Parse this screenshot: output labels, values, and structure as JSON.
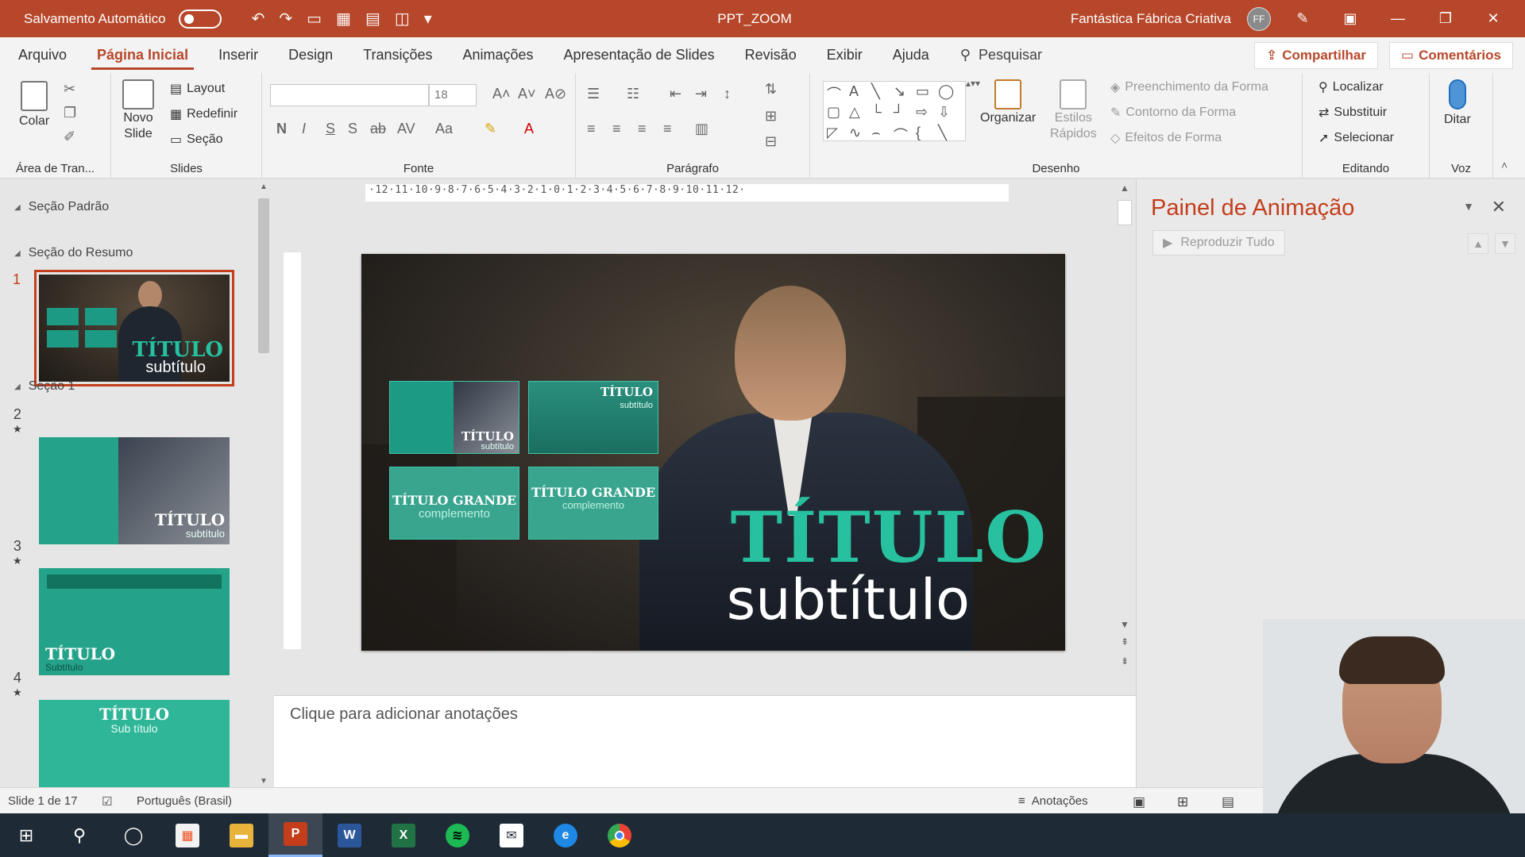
{
  "titlebar": {
    "autosave_label": "Salvamento Automático",
    "doc_title": "PPT_ZOOM",
    "account_name": "Fantástica Fábrica Criativa",
    "account_initials": "FF"
  },
  "tabs": [
    "Arquivo",
    "Página Inicial",
    "Inserir",
    "Design",
    "Transições",
    "Animações",
    "Apresentação de Slides",
    "Revisão",
    "Exibir",
    "Ajuda"
  ],
  "active_tab": "Página Inicial",
  "search": {
    "label": "Pesquisar"
  },
  "share_label": "Compartilhar",
  "comments_label": "Comentários",
  "ribbon": {
    "clipboard": {
      "label": "Área de Tran...",
      "paste": "Colar"
    },
    "slides": {
      "label": "Slides",
      "new_slide_1": "Novo",
      "new_slide_2": "Slide",
      "layout": "Layout",
      "reset": "Redefinir",
      "section": "Seção"
    },
    "font": {
      "label": "Fonte",
      "size": "18",
      "bold": "N",
      "italic": "I",
      "underline": "S",
      "shadow": "S",
      "strike": "ab",
      "case": "Aa"
    },
    "paragraph": {
      "label": "Parágrafo"
    },
    "drawing": {
      "label": "Desenho",
      "arrange": "Organizar",
      "quick_styles_1": "Estilos",
      "quick_styles_2": "Rápidos",
      "fill": "Preenchimento da Forma",
      "outline": "Contorno da Forma",
      "effects": "Efeitos de Forma"
    },
    "editing": {
      "label": "Editando",
      "find": "Localizar",
      "replace": "Substituir",
      "select": "Selecionar"
    },
    "voice": {
      "label": "Voz",
      "dictate": "Ditar"
    }
  },
  "thumbnails": {
    "sections": [
      "Seção Padrão",
      "Seção do Resumo",
      "Seção 1"
    ],
    "slides": [
      {
        "num": "1",
        "title": "TÍTULO",
        "subtitle": "subtítulo"
      },
      {
        "num": "2",
        "title": "TÍTULO",
        "subtitle": "subtítulo"
      },
      {
        "num": "3",
        "title": "TÍTULO",
        "subtitle": "Subtítulo"
      },
      {
        "num": "4",
        "title": "TÍTULO",
        "subtitle": "Sub título"
      }
    ],
    "star": "★"
  },
  "ruler": {
    "h_ticks": "·12·11·10·9·8·7·6·5·4·3·2·1·0·1·2·3·4·5·6·7·8·9·10·11·12·"
  },
  "slide": {
    "title": "TÍTULO",
    "subtitle": "subtítulo",
    "cards": [
      {
        "title": "TÍTULO",
        "subtitle": "subtítulo"
      },
      {
        "title": "TÍTULO",
        "subtitle": "subtítulo"
      },
      {
        "title": "TÍTULO GRANDE",
        "subtitle": "complemento"
      },
      {
        "title": "TÍTULO GRANDE",
        "subtitle": "complemento"
      }
    ]
  },
  "notes_placeholder": "Clique para adicionar anotações",
  "animation_pane": {
    "title": "Painel de Animação",
    "play_all": "Reproduzir Tudo"
  },
  "statusbar": {
    "slide_info": "Slide 1 de 17",
    "language": "Português (Brasil)",
    "notes": "Anotações"
  },
  "colors": {
    "accent": "#b7472a",
    "title_teal": "#27c19f",
    "taskbar": "#1e2a36"
  }
}
